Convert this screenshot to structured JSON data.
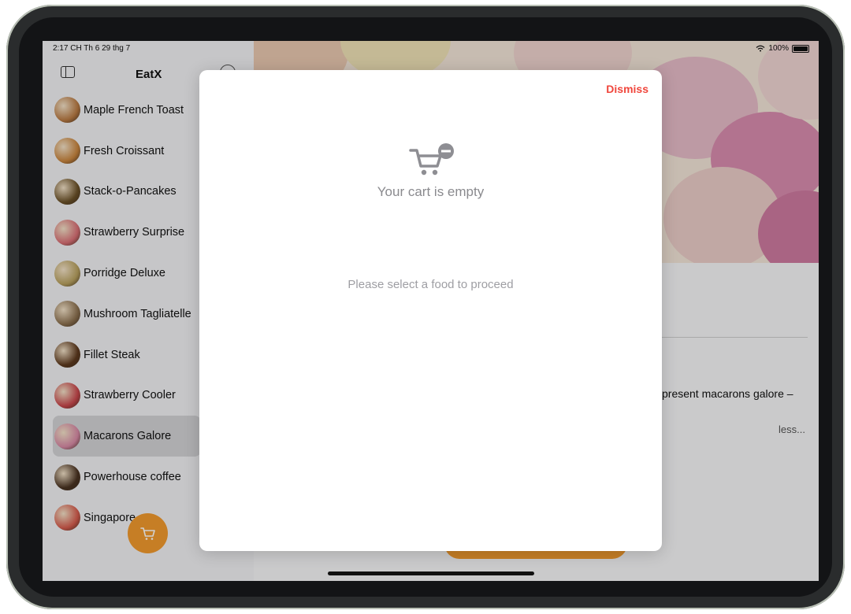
{
  "status_bar": {
    "time": "2:17 CH  Th 6 29 thg 7",
    "battery": "100%"
  },
  "sidebar": {
    "title": "EatX",
    "items": [
      {
        "label": "Maple French Toast",
        "color": "#b97a43"
      },
      {
        "label": "Fresh Croissant",
        "color": "#c9853e"
      },
      {
        "label": "Stack-o-Pancakes",
        "color": "#6b5128"
      },
      {
        "label": "Strawberry Surprise",
        "color": "#d96f75"
      },
      {
        "label": "Porridge Deluxe",
        "color": "#b8a15f"
      },
      {
        "label": "Mushroom Tagliatelle",
        "color": "#8c7150"
      },
      {
        "label": "Fillet Steak",
        "color": "#5e3a1e"
      },
      {
        "label": "Strawberry Cooler",
        "color": "#c9474c"
      },
      {
        "label": "Macarons Galore",
        "color": "#d88aa6",
        "selected": true
      },
      {
        "label": "Powerhouse coffee",
        "color": "#4a3322"
      },
      {
        "label": "Singapore",
        "color": "#d65c4d"
      }
    ],
    "cart_button_color": "#f29a2e"
  },
  "detail": {
    "description_fragment": "present macarons galore –",
    "less_link": "less...",
    "order_button_color": "#f29a2e"
  },
  "modal": {
    "dismiss_label": "Dismiss",
    "empty_title": "Your cart is empty",
    "empty_hint": "Please select a food to proceed",
    "icon": "cart-remove-icon"
  }
}
